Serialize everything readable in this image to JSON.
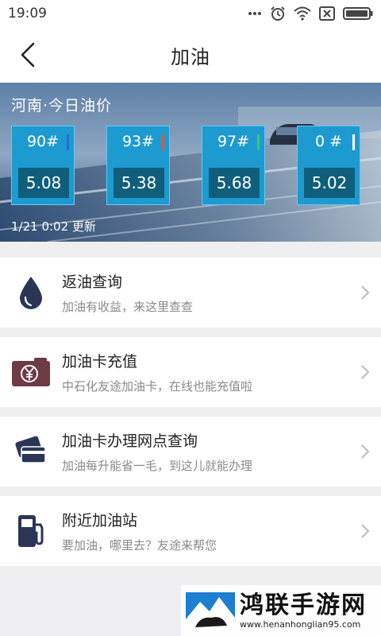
{
  "status_bar": {
    "time": "19:09",
    "icons": [
      "more-dots-icon",
      "alarm-icon",
      "wifi-icon",
      "sim-off-icon",
      "battery-icon"
    ]
  },
  "nav": {
    "title": "加油",
    "back_icon": "chevron-left-icon"
  },
  "banner": {
    "title": "河南·今日油价",
    "updated": "1/21 0:02  更新",
    "prices": [
      {
        "grade": "90#",
        "value": "5.08",
        "mark_color": "#1e6fd9"
      },
      {
        "grade": "93#",
        "value": "5.38",
        "mark_color": "#e0563c"
      },
      {
        "grade": "97#",
        "value": "5.68",
        "mark_color": "#3fc768"
      },
      {
        "grade": "0 #",
        "value": "5.02",
        "mark_color": "#ffffff"
      }
    ]
  },
  "menu": [
    {
      "title": "返油查询",
      "subtitle": "加油有收益，来这里查查",
      "icon": "oil-drop-icon"
    },
    {
      "title": "加油卡充值",
      "subtitle": "中石化友途加油卡，在线也能充值啦",
      "icon": "yen-wallet-icon"
    },
    {
      "title": "加油卡办理网点查询",
      "subtitle": "加油每升能省一毛，到这儿就能办理",
      "icon": "cards-icon"
    },
    {
      "title": "附近加油站",
      "subtitle": "要加油，哪里去？友途来帮您",
      "icon": "gas-pump-icon"
    }
  ],
  "watermark": {
    "brand": "鸿联手游网",
    "url": "www.henanhonglian95.com"
  },
  "colors": {
    "accent_blue": "#1d9bd1",
    "dark_teal": "#0f5f7c",
    "icon_navy": "#2b3556",
    "icon_maroon": "#6e3a46"
  }
}
